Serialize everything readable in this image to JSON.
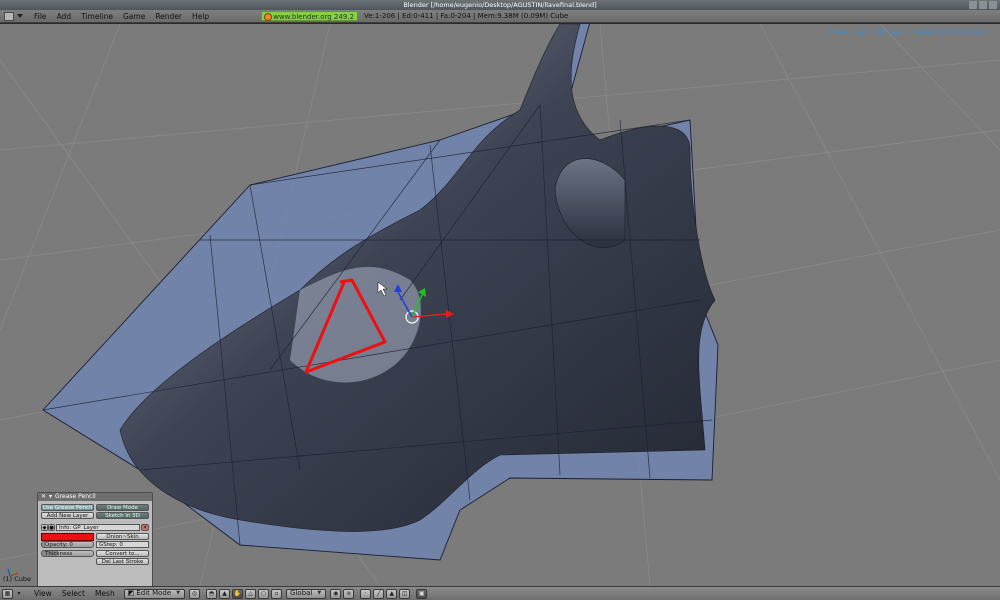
{
  "window": {
    "title": "Blender [/home/eugenio/Desktop/AGUSTIN/llavefinal.blend]"
  },
  "header": {
    "menu": [
      "File",
      "Add",
      "Timeline",
      "Game",
      "Render",
      "Help"
    ],
    "site_badge": "www.blender.org 249.2",
    "stats": "Ve:1-206 | Ed:0-411 | Fa:0-204 | Mem:9.38M (0.09M) Cube"
  },
  "viewport": {
    "gp_info": "GPencil: Layer ('GP_Layer'), Frame (1), Draw Mode On",
    "object_label": "(1) Cube"
  },
  "grease_panel": {
    "title": "Grease Pencil",
    "use_label": "Use Grease Pencil",
    "draw_mode_label": "Draw Mode",
    "add_layer_label": "Add New Layer",
    "sketch_label": "Sketch in 3D",
    "layer_name": "Info: GP_Layer",
    "stroke_color": "#ee1010",
    "onion_label": "Onion~Skin",
    "opacity_label": "Opacity: 0",
    "opacity_level": 0.05,
    "gstep_label": "GStep: 0",
    "thickness_label": "Thickness",
    "thickness_level": 0.3,
    "convert_label": "Convert to...",
    "del_label": "Del Last Stroke"
  },
  "bottombar": {
    "menu": [
      "View",
      "Select",
      "Mesh"
    ],
    "mode": "Edit Mode",
    "orientation": "Global"
  },
  "icons": {
    "window_type": "viewport-icon",
    "grid": "grid-icon"
  },
  "colors": {
    "viewport_bg": "#7b7b7b",
    "mesh_blue": "#6e86b8",
    "stroke_red": "#ee1010",
    "badge_green": "#8acd4a",
    "info_blue": "#3c8fd7"
  }
}
